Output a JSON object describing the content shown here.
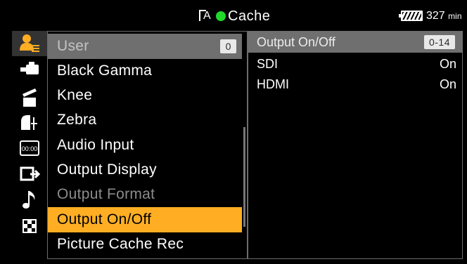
{
  "status": {
    "cache_label": "Cache",
    "battery_minutes": "327",
    "battery_unit": "min"
  },
  "menu": {
    "header": {
      "label": "User",
      "page": "0"
    },
    "items": [
      {
        "label": "Black Gamma"
      },
      {
        "label": "Knee"
      },
      {
        "label": "Zebra"
      },
      {
        "label": "Audio Input"
      },
      {
        "label": "Output Display"
      },
      {
        "label": "Output Format"
      },
      {
        "label": "Output On/Off"
      },
      {
        "label": "Picture Cache Rec"
      }
    ]
  },
  "settings": {
    "title": "Output On/Off",
    "range": "0-14",
    "rows": [
      {
        "name": "SDI",
        "value": "On"
      },
      {
        "name": "HDMI",
        "value": "On"
      }
    ]
  },
  "colors": {
    "selected_bg": "#ffae24",
    "header_bg": "#6f6f6f",
    "rec_indicator": "#21d92b",
    "disabled_text": "#8b8b8b"
  },
  "icons": {
    "categories": [
      "user-menu-icon",
      "camera-icon",
      "clapper-icon",
      "paint-icon",
      "timecode-icon",
      "output-icon",
      "audio-note-icon",
      "grid-icon"
    ]
  }
}
